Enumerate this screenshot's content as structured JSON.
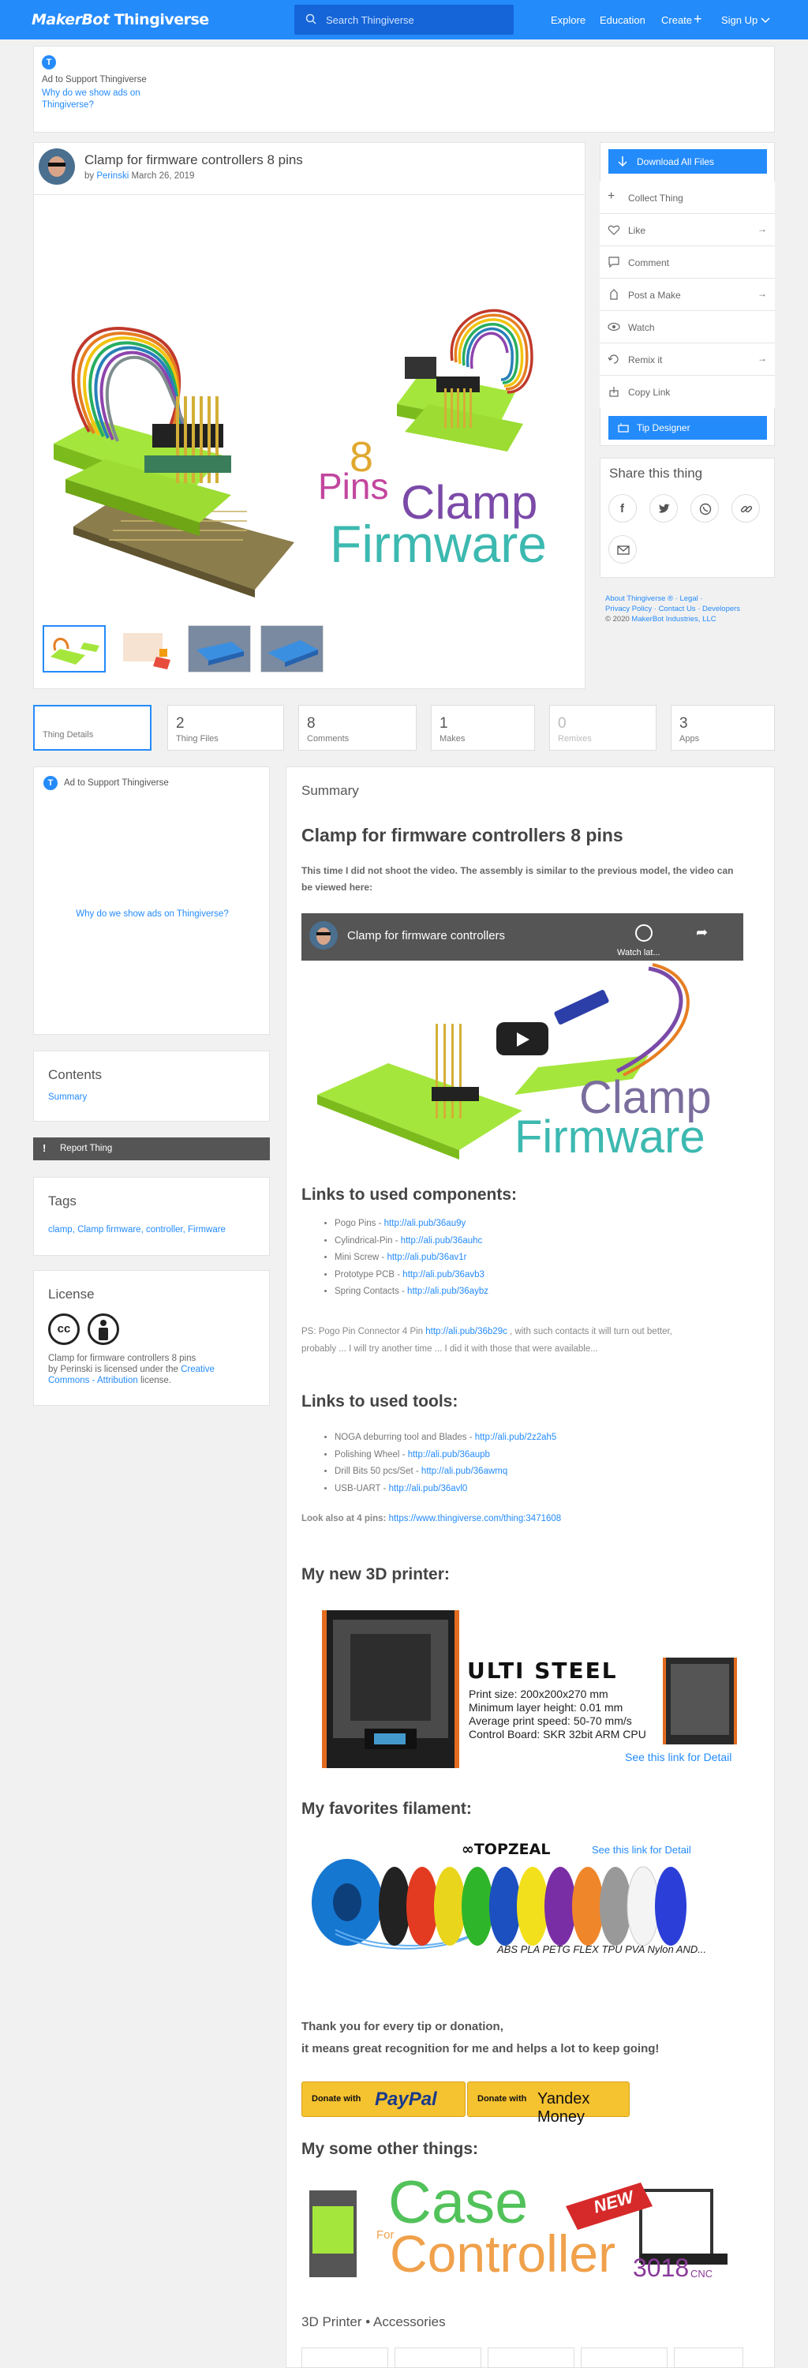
{
  "header": {
    "logo_a": "MakerBot",
    "logo_b": "Thingiverse",
    "search_placeholder": "Search Thingiverse",
    "nav": [
      "Explore",
      "Education",
      "Create",
      "Sign Up"
    ]
  },
  "ad_top": {
    "label": "Ad to Support Thingiverse",
    "why": "Why do we show ads on Thingiverse?"
  },
  "thing": {
    "title": "Clamp for firmware controllers 8 pins",
    "by": "by",
    "author": "Perinski",
    "date": "March 26, 2019"
  },
  "hero": {
    "word_8": "8",
    "word_pins": "Pins",
    "word_clamp": "Clamp",
    "word_firmware": "Firmware"
  },
  "sidebar": {
    "download": "Download All Files",
    "collect": "Collect Thing",
    "like": "Like",
    "comment": "Comment",
    "post_make": "Post a Make",
    "watch": "Watch",
    "remix": "Remix it",
    "copy": "Copy Link",
    "tip": "Tip Designer",
    "share_title": "Share this thing"
  },
  "footer_links": {
    "line1": "About Thingiverse ® · Legal ·",
    "line2": "Privacy Policy · Contact Us · Developers",
    "copyright": "© 2020",
    "company": "MakerBot Industries, LLC"
  },
  "tabs": [
    {
      "n": "",
      "l": "Thing Details"
    },
    {
      "n": "2",
      "l": "Thing Files"
    },
    {
      "n": "8",
      "l": "Comments"
    },
    {
      "n": "1",
      "l": "Makes"
    },
    {
      "n": "0",
      "l": "Remixes"
    },
    {
      "n": "3",
      "l": "Apps"
    }
  ],
  "left": {
    "ad_label": "Ad to Support Thingiverse",
    "ad_why": "Why do we show ads on Thingiverse?",
    "contents_title": "Contents",
    "contents_item": "Summary",
    "report": "Report Thing",
    "tags_title": "Tags",
    "tags": "clamp, Clamp firmware, controller, Firmware",
    "license_title": "License",
    "license_text1": "Clamp for firmware controllers 8 pins",
    "license_text2": "by Perinski is licensed under the",
    "license_link": "Creative Commons - Attribution",
    "license_text3": "license."
  },
  "summary": {
    "label": "Summary",
    "title": "Clamp for firmware controllers 8 pins",
    "intro": "This time I did not shoot the video. The assembly is similar to the previous model, the video can be viewed here:",
    "video_title": "Clamp for firmware controllers",
    "video_watch": "Watch lat...",
    "video_clamp": "Clamp",
    "video_firmware": "Firmware",
    "components_title": "Links to used components:",
    "components": [
      {
        "t": "Pogo Pins - ",
        "u": "http://ali.pub/36au9y"
      },
      {
        "t": "Cylindrical-Pin - ",
        "u": "http://ali.pub/36auhc"
      },
      {
        "t": "Mini Screw - ",
        "u": "http://ali.pub/36av1r"
      },
      {
        "t": "Prototype PCB - ",
        "u": "http://ali.pub/36avb3"
      },
      {
        "t": "Spring Contacts - ",
        "u": "http://ali.pub/36aybz"
      }
    ],
    "ps_a": "PS: Pogo Pin Connector 4 Pin ",
    "ps_link": "http://ali.pub/36b29c",
    "ps_b": " , with such contacts it will turn out better,",
    "ps_c": "probably ... I will try another time ... I did it with those that were available...",
    "tools_title": "Links to used tools:",
    "tools": [
      {
        "t": "NOGA deburring tool and Blades - ",
        "u": "http://ali.pub/2z2ah5"
      },
      {
        "t": "Polishing Wheel - ",
        "u": "http://ali.pub/36aupb"
      },
      {
        "t": "Drill Bits 50 pcs/Set - ",
        "u": "http://ali.pub/36awmq"
      },
      {
        "t": "USB-UART - ",
        "u": "http://ali.pub/36avl0"
      }
    ],
    "look_a": "Look also at 4 pins: ",
    "look_link": "https://www.thingiverse.com/thing:3471608",
    "printer_title": "My new 3D printer:",
    "printer": {
      "name": "ULTI STEEL",
      "l1": "Print size: 200x200x270 mm",
      "l2": "Minimum layer height: 0.01 mm",
      "l3": "Average print speed: 50-70 mm/s",
      "l4": "Control Board: SKR 32bit ARM CPU",
      "detail": "See this link for Detail"
    },
    "filament_title": "My favorites filament:",
    "filament": {
      "brand": "TOPZEAL",
      "detail": "See this link for Detail",
      "types": "ABS PLA PETG FLEX TPU PVA Nylon AND..."
    },
    "thanks1": "Thank you for every tip or donation,",
    "thanks2": "it means great recognition for me and helps a lot to keep going!",
    "donate_paypal": "Donate with",
    "paypal": "PayPal",
    "donate_yandex": "Donate with",
    "yandex": "Yandex Money",
    "other_title": "My some other things:",
    "other": {
      "case": "Case",
      "for": "For",
      "controller": "Controller",
      "new": "NEW",
      "cnc": "3018",
      "cnc2": "CNC"
    },
    "accessories": "3D Printer • Accessories"
  }
}
